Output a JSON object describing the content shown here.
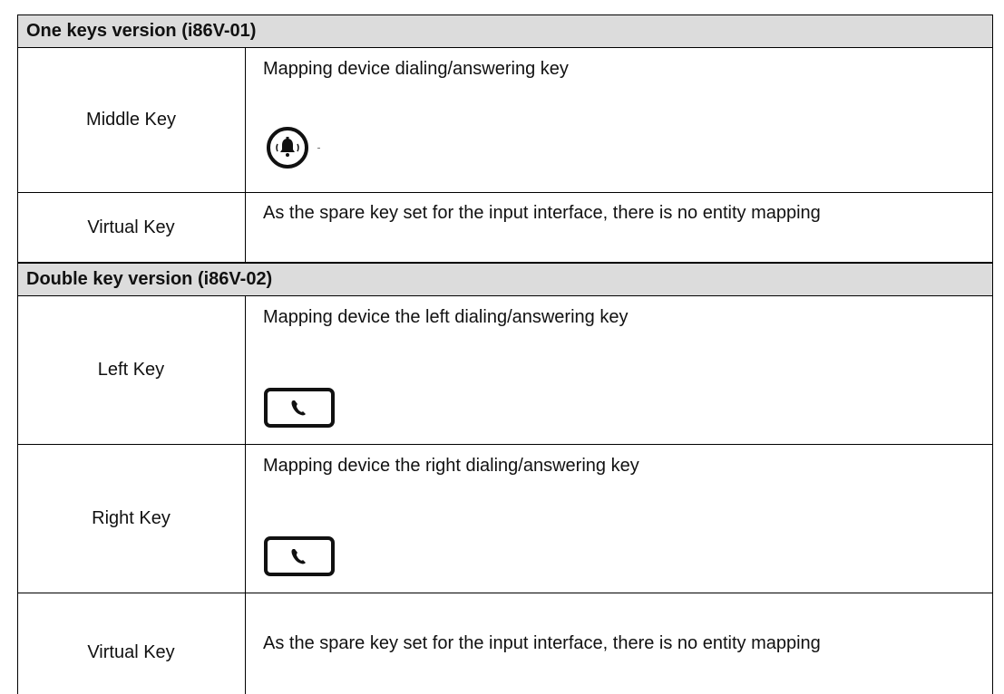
{
  "sections": [
    {
      "title": "One keys version (i86V-01)",
      "rows": [
        {
          "key": "Middle Key",
          "description": "Mapping device dialing/answering key",
          "icon": "bell-circle-icon"
        },
        {
          "key": "Virtual Key",
          "description": "As the spare key set for the input interface, there is no entity mapping"
        }
      ]
    },
    {
      "title": "Double key version (i86V-02)",
      "rows": [
        {
          "key": "Left Key",
          "description": "Mapping device the left dialing/answering key",
          "icon": "phone-button-icon"
        },
        {
          "key": "Right Key",
          "description": "Mapping device the right dialing/answering key",
          "icon": "phone-button-icon"
        },
        {
          "key": "Virtual Key",
          "description": "As the spare key set for the input interface, there is no entity mapping"
        }
      ]
    }
  ]
}
